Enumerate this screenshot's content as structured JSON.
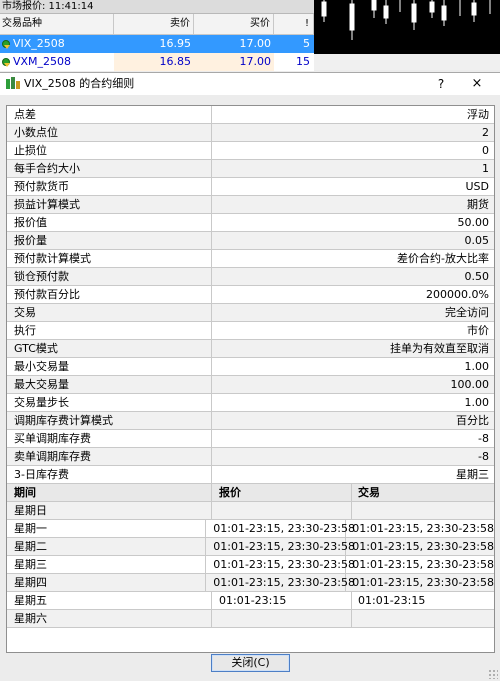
{
  "market_watch": {
    "title": "市场报价: 11:41:14",
    "columns": {
      "symbol": "交易品种",
      "bid": "卖价",
      "ask": "买价",
      "extra": "!"
    },
    "rows": [
      {
        "symbol": "VIX_2508",
        "bid": "16.95",
        "ask": "17.00",
        "extra": "5",
        "selected": true
      },
      {
        "symbol": "VXM_2508",
        "bid": "16.85",
        "ask": "17.00",
        "extra": "15",
        "selected": false
      }
    ]
  },
  "dialog": {
    "title": "VIX_2508 的合约细则",
    "help": "?",
    "close": "×",
    "close_button": "关闭(C)",
    "properties": [
      {
        "key": "点差",
        "value": "浮动"
      },
      {
        "key": "小数点位",
        "value": "2"
      },
      {
        "key": "止损位",
        "value": "0"
      },
      {
        "key": "每手合约大小",
        "value": "1"
      },
      {
        "key": "预付款货币",
        "value": "USD"
      },
      {
        "key": "损益计算模式",
        "value": "期货"
      },
      {
        "key": "报价值",
        "value": "50.00"
      },
      {
        "key": "报价量",
        "value": "0.05"
      },
      {
        "key": "预付款计算模式",
        "value": "差价合约-放大比率"
      },
      {
        "key": "锁仓预付款",
        "value": "0.50"
      },
      {
        "key": "预付款百分比",
        "value": "200000.0%"
      },
      {
        "key": "交易",
        "value": "完全访问"
      },
      {
        "key": "执行",
        "value": "市价"
      },
      {
        "key": "GTC模式",
        "value": "挂单为有效直至取消"
      },
      {
        "key": "最小交易量",
        "value": "1.00"
      },
      {
        "key": "最大交易量",
        "value": "100.00"
      },
      {
        "key": "交易量步长",
        "value": "1.00"
      },
      {
        "key": "调期库存费计算模式",
        "value": "百分比"
      },
      {
        "key": "买单调期库存费",
        "value": "-8"
      },
      {
        "key": "卖单调期库存费",
        "value": "-8"
      },
      {
        "key": "3-日库存费",
        "value": "星期三"
      }
    ],
    "sessions_header": {
      "period": "期间",
      "quote": "报价",
      "trade": "交易"
    },
    "sessions": [
      {
        "day": "星期日",
        "quote": "",
        "trade": ""
      },
      {
        "day": "星期一",
        "quote": "01:01-23:15, 23:30-23:58",
        "trade": "01:01-23:15, 23:30-23:58"
      },
      {
        "day": "星期二",
        "quote": "01:01-23:15, 23:30-23:58",
        "trade": "01:01-23:15, 23:30-23:58"
      },
      {
        "day": "星期三",
        "quote": "01:01-23:15, 23:30-23:58",
        "trade": "01:01-23:15, 23:30-23:58"
      },
      {
        "day": "星期四",
        "quote": "01:01-23:15, 23:30-23:58",
        "trade": "01:01-23:15, 23:30-23:58"
      },
      {
        "day": "星期五",
        "quote": "01:01-23:15",
        "trade": "01:01-23:15"
      },
      {
        "day": "星期六",
        "quote": "",
        "trade": ""
      }
    ]
  },
  "colors": {
    "selection": "#3399ff",
    "symbol_text": "#0000c8",
    "chart_bg": "#000000",
    "candle": "#ffffff"
  },
  "icons": [
    "symbol-icon",
    "contract-spec-icon",
    "help-icon",
    "close-icon",
    "resize-grip-icon"
  ]
}
